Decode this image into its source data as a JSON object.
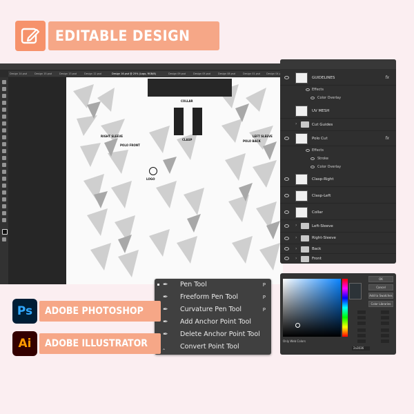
{
  "banner": {
    "title": "EDITABLE DESIGN",
    "icon": "pencil-square-icon"
  },
  "photoshop": {
    "tabs": [
      "Design 14.psd",
      "Design 15.psd",
      "Design 13.psd",
      "Design 12.psd",
      "Design 16.psd @ 25% (Logo, RGB/8)",
      "Design 09.psd",
      "Design 05.psd",
      "Design 08.psd",
      "Design 01.psd",
      "Design 04.psd"
    ],
    "canvas_labels": {
      "collar": "COLLAR",
      "clasp": "CLASP",
      "right_sleeve": "RIGHT SLEEVE",
      "left_sleeve": "LEFT SLEEVE",
      "polo_front": "POLO FRONT",
      "polo_back": "POLO BACK",
      "logo": "LOGO"
    }
  },
  "layers": {
    "items": [
      {
        "name": "GUIDELINES",
        "type": "layer",
        "fx": true
      },
      {
        "name": "Effects",
        "type": "effect-group"
      },
      {
        "name": "Color Overlay",
        "type": "effect"
      },
      {
        "name": "UV MESH",
        "type": "layer"
      },
      {
        "name": "Cut Guides",
        "type": "folder"
      },
      {
        "name": "Polo Cut",
        "type": "layer",
        "fx": true
      },
      {
        "name": "Effects",
        "type": "effect-group"
      },
      {
        "name": "Stroke",
        "type": "effect"
      },
      {
        "name": "Color Overlay",
        "type": "effect"
      },
      {
        "name": "Clasp-Right",
        "type": "layer"
      },
      {
        "name": "Clasp-Left",
        "type": "layer"
      },
      {
        "name": "Collar",
        "type": "layer"
      },
      {
        "name": "Left-Sleeve",
        "type": "folder"
      },
      {
        "name": "Right-Sleeve",
        "type": "folder"
      },
      {
        "name": "Back",
        "type": "folder"
      },
      {
        "name": "Front",
        "type": "folder"
      }
    ],
    "fx_label": "fx"
  },
  "color_picker": {
    "buttons": [
      "OK",
      "Cancel",
      "Add to Swatches",
      "Color Libraries"
    ],
    "only_web_colors": "Only Web Colors",
    "hex": "2a3036",
    "current_color": "#2c3338"
  },
  "pen_menu": {
    "items": [
      {
        "label": "Pen Tool",
        "shortcut": "P",
        "icon": "pen-icon",
        "selected": true
      },
      {
        "label": "Freeform Pen Tool",
        "shortcut": "P",
        "icon": "freeform-pen-icon"
      },
      {
        "label": "Curvature Pen Tool",
        "shortcut": "P",
        "icon": "curvature-pen-icon"
      },
      {
        "label": "Add Anchor Point Tool",
        "shortcut": "",
        "icon": "add-anchor-icon"
      },
      {
        "label": "Delete Anchor Point Tool",
        "shortcut": "",
        "icon": "delete-anchor-icon"
      },
      {
        "label": "Convert Point Tool",
        "shortcut": "",
        "icon": "convert-point-icon"
      }
    ]
  },
  "apps": [
    {
      "abbr": "Ps",
      "label": "ADOBE PHOTOSHOP",
      "icon": "photoshop-icon"
    },
    {
      "abbr": "Ai",
      "label": "ADOBE ILLUSTRATOR",
      "icon": "illustrator-icon"
    }
  ],
  "colors": {
    "background": "#fbeef1",
    "accent": "#f6a787",
    "accent_dark": "#f6926b"
  }
}
